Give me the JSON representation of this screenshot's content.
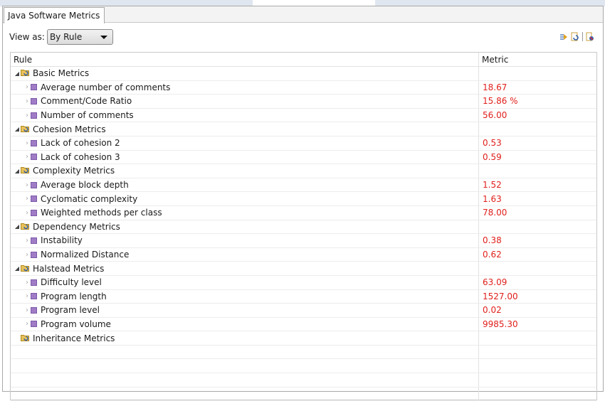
{
  "tab": {
    "label": "Java Software Metrics"
  },
  "view_as": {
    "label": "View as:",
    "selected": "By Rule"
  },
  "toolbar": {
    "icons": [
      "expand-icon",
      "export-icon",
      "settings-icon"
    ]
  },
  "table": {
    "columns": [
      "Rule",
      "Metric"
    ],
    "metric_color": "#e0201c",
    "rows": [
      {
        "type": "group",
        "label": "Basic Metrics",
        "value": ""
      },
      {
        "type": "item",
        "label": "Average number of comments",
        "value": "18.67"
      },
      {
        "type": "item",
        "label": "Comment/Code Ratio",
        "value": "15.86 %"
      },
      {
        "type": "item",
        "label": "Number of comments",
        "value": "56.00"
      },
      {
        "type": "group",
        "label": "Cohesion Metrics",
        "value": ""
      },
      {
        "type": "item",
        "label": "Lack of cohesion 2",
        "value": "0.53"
      },
      {
        "type": "item",
        "label": "Lack of cohesion 3",
        "value": "0.59"
      },
      {
        "type": "group",
        "label": "Complexity Metrics",
        "value": ""
      },
      {
        "type": "item",
        "label": "Average block depth",
        "value": "1.52"
      },
      {
        "type": "item",
        "label": "Cyclomatic complexity",
        "value": "1.63"
      },
      {
        "type": "item",
        "label": "Weighted methods per class",
        "value": "78.00"
      },
      {
        "type": "group",
        "label": "Dependency Metrics",
        "value": ""
      },
      {
        "type": "item",
        "label": "Instability",
        "value": "0.38"
      },
      {
        "type": "item",
        "label": "Normalized Distance",
        "value": "0.62"
      },
      {
        "type": "group",
        "label": "Halstead Metrics",
        "value": ""
      },
      {
        "type": "item",
        "label": "Difficulty level",
        "value": "63.09"
      },
      {
        "type": "item",
        "label": "Program length",
        "value": "1527.00"
      },
      {
        "type": "item",
        "label": "Program level",
        "value": "0.02"
      },
      {
        "type": "item",
        "label": "Program volume",
        "value": "9985.30"
      },
      {
        "type": "group-empty",
        "label": "Inheritance Metrics",
        "value": ""
      }
    ]
  }
}
